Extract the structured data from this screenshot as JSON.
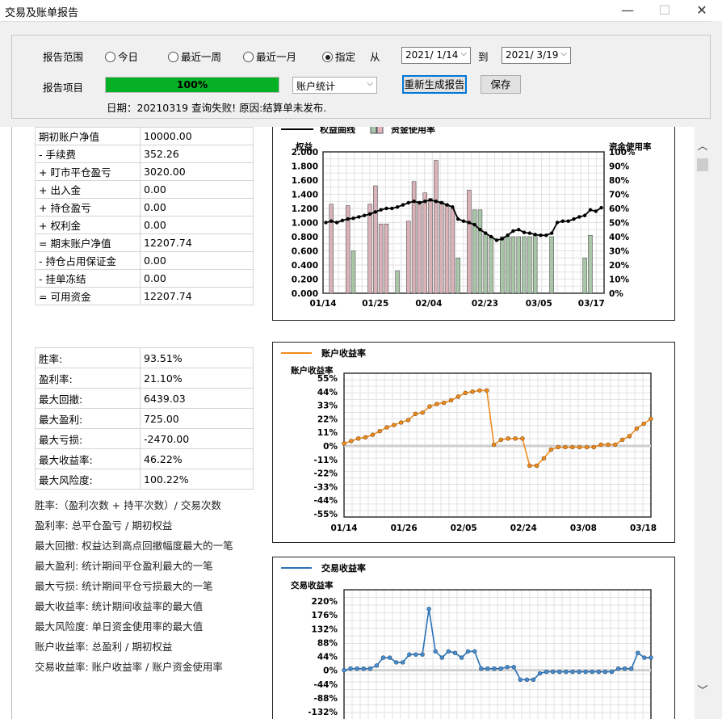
{
  "window": {
    "title": "交易及账单报告",
    "min": "—",
    "max": "☐",
    "close": "✕"
  },
  "toolbar": {
    "range_label": "报告范围",
    "radios": [
      {
        "label": "今日",
        "selected": false
      },
      {
        "label": "最近一周",
        "selected": false
      },
      {
        "label": "最近一月",
        "selected": false
      },
      {
        "label": "指定",
        "selected": true
      }
    ],
    "from_label": "从",
    "to_label": "到",
    "date_from": "2021/  1/14",
    "date_to": "2021/  3/19",
    "item_label": "报告项目",
    "progress": "100%",
    "progress_value": 1.0,
    "select_value": "账户统计",
    "regen_label": "重新生成报告",
    "save_label": "保存",
    "status": "日期：20210319 查询失败! 原因:结算单未发布."
  },
  "account": [
    {
      "k": "期初账户净值",
      "v": "10000.00"
    },
    {
      "k": "- 手续费",
      "v": "352.26"
    },
    {
      "k": "+ 盯市平仓盈亏",
      "v": "3020.00"
    },
    {
      "k": "+ 出入金",
      "v": "0.00"
    },
    {
      "k": "+ 持仓盈亏",
      "v": "0.00"
    },
    {
      "k": "+ 权利金",
      "v": "0.00"
    },
    {
      "k": "= 期末账户净值",
      "v": "12207.74"
    },
    {
      "k": "- 持仓占用保证金",
      "v": "0.00"
    },
    {
      "k": "- 挂单冻结",
      "v": "0.00"
    },
    {
      "k": "= 可用资金",
      "v": "12207.74"
    }
  ],
  "stats": [
    {
      "k": "胜率:",
      "v": "93.51%"
    },
    {
      "k": "盈利率:",
      "v": "21.10%"
    },
    {
      "k": "最大回撤:",
      "v": "6439.03"
    },
    {
      "k": "最大盈利:",
      "v": "725.00"
    },
    {
      "k": "最大亏损:",
      "v": "-2470.00"
    },
    {
      "k": "最大收益率:",
      "v": "46.22%"
    },
    {
      "k": "最大风险度:",
      "v": "100.22%"
    }
  ],
  "definitions": [
    "胜率:（盈利次数 + 持平次数）/ 交易次数",
    "盈利率: 总平仓盈亏 / 期初权益",
    "最大回撤: 权益达到高点回撤幅度最大的一笔",
    "最大盈利: 统计期间平仓盈利最大的一笔",
    "最大亏损: 统计期间平仓亏损最大的一笔",
    "最大收益率: 统计期间收益率的最大值",
    "最大风险度: 单日资金使用率的最大值",
    "账户收益率: 总盈利 / 期初权益",
    "交易收益率: 账户收益率 / 账户资金使用率"
  ],
  "chart_data": [
    {
      "type": "line",
      "legend": [
        "权益曲线",
        "资金使用率"
      ],
      "ylabel": "权益",
      "y2label": "资金使用率",
      "ylim": [
        0,
        2.0
      ],
      "y2lim": [
        0,
        100
      ],
      "yticks": [
        "0.000",
        "0.200",
        "0.400",
        "0.600",
        "0.800",
        "1.000",
        "1.200",
        "1.400",
        "1.600",
        "1.800",
        "2.000"
      ],
      "y2ticks": [
        "0%",
        "10%",
        "20%",
        "30%",
        "40%",
        "50%",
        "60%",
        "70%",
        "80%",
        "90%",
        "100%"
      ],
      "xticks": [
        "01/14",
        "01/25",
        "02/04",
        "02/23",
        "03/05",
        "03/17"
      ],
      "series": [
        {
          "name": "权益曲线",
          "values": [
            1.0,
            1.02,
            1.0,
            1.03,
            1.05,
            1.06,
            1.08,
            1.1,
            1.12,
            1.15,
            1.18,
            1.2,
            1.2,
            1.22,
            1.25,
            1.28,
            1.3,
            1.28,
            1.3,
            1.32,
            1.3,
            1.28,
            1.25,
            1.22,
            1.05,
            1.02,
            1.0,
            0.97,
            0.9,
            0.85,
            0.8,
            0.75,
            0.77,
            0.82,
            0.88,
            0.9,
            0.86,
            0.85,
            0.83,
            0.82,
            0.82,
            0.85,
            1.0,
            1.02,
            1.02,
            1.05,
            1.08,
            1.1,
            1.18,
            1.16,
            1.21
          ]
        },
        {
          "name": "资金使用率",
          "values": [
            0,
            63,
            0,
            0,
            62,
            30,
            0,
            0,
            63,
            76,
            49,
            49,
            0,
            16,
            0,
            51,
            79,
            65,
            71,
            67,
            94,
            65,
            63,
            60,
            25,
            0,
            73,
            59,
            59,
            42,
            40,
            0,
            40,
            40,
            40,
            40,
            40,
            40,
            41,
            0,
            0,
            40,
            0,
            0,
            0,
            0,
            0,
            25,
            41,
            0,
            0
          ]
        }
      ]
    },
    {
      "type": "line",
      "legend": [
        "账户收益率"
      ],
      "ylabel": "账户收益率",
      "ylim": [
        -55,
        55
      ],
      "yticks": [
        "55%",
        "44%",
        "33%",
        "22%",
        "11%",
        "0%",
        "-11%",
        "-22%",
        "-33%",
        "-44%",
        "-55%"
      ],
      "xticks": [
        "01/14",
        "01/26",
        "02/05",
        "02/24",
        "03/08",
        "03/18"
      ],
      "series": [
        {
          "name": "账户收益率",
          "values": [
            2,
            4,
            6,
            7,
            9,
            12,
            15,
            17,
            19,
            21,
            26,
            27,
            32,
            34,
            35,
            37,
            40,
            43,
            44,
            45,
            45,
            1,
            5,
            6,
            6,
            6,
            -16,
            -16,
            -10,
            -3,
            -1,
            -1,
            -1,
            -1,
            -1,
            -1,
            1,
            1,
            1,
            5,
            8,
            14,
            18,
            22
          ]
        }
      ]
    },
    {
      "type": "line",
      "legend": [
        "交易收益率"
      ],
      "ylabel": "交易收益率",
      "ylim": [
        -132,
        220
      ],
      "yticks": [
        "220%",
        "176%",
        "132%",
        "88%",
        "44%",
        "0%",
        "-44%",
        "-88%",
        "-132%"
      ],
      "series": [
        {
          "name": "交易收益率",
          "values": [
            0,
            5,
            5,
            5,
            5,
            15,
            40,
            40,
            25,
            25,
            50,
            50,
            50,
            195,
            60,
            40,
            60,
            55,
            40,
            60,
            60,
            5,
            5,
            5,
            5,
            10,
            10,
            -30,
            -30,
            -30,
            -10,
            -5,
            -5,
            -5,
            -5,
            -5,
            -5,
            -5,
            -5,
            -5,
            -5,
            -5,
            5,
            5,
            5,
            55,
            40,
            40
          ]
        }
      ]
    }
  ]
}
